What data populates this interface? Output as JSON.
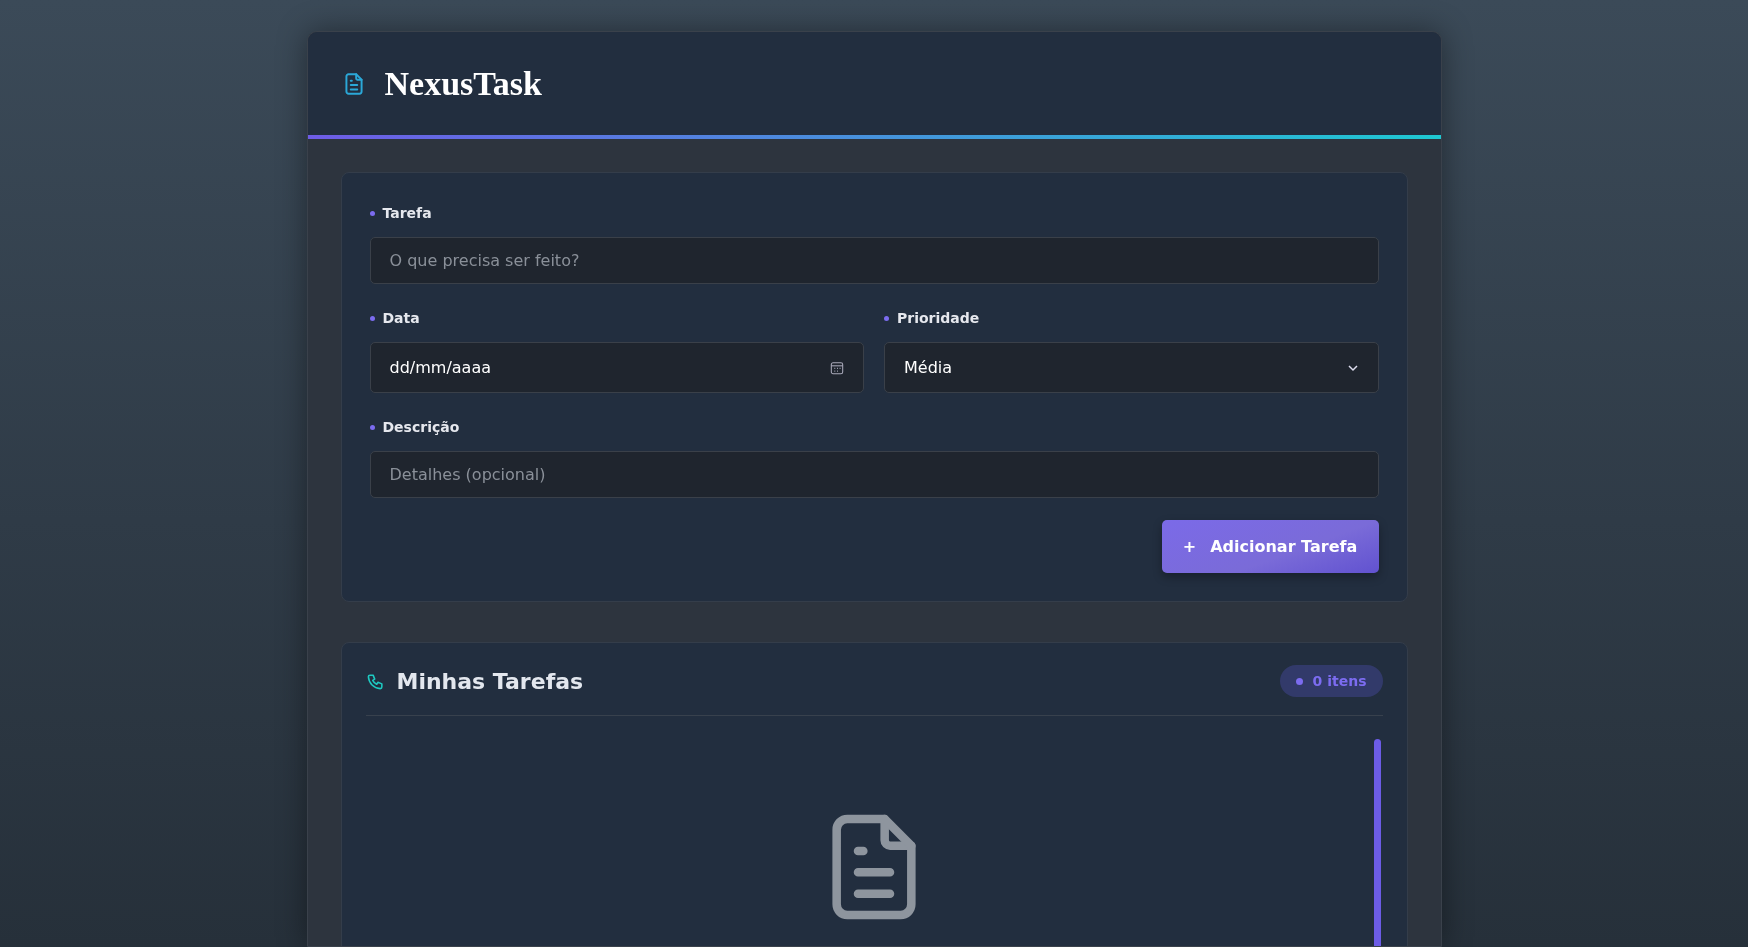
{
  "app": {
    "title": "NexusTask"
  },
  "form": {
    "fields": [
      {
        "kind": "text",
        "label": "Tarefa",
        "placeholder": "O que precisa ser feito?"
      },
      {
        "kind": "date",
        "label": "Data",
        "value": "dd/mm/aaaa"
      },
      {
        "kind": "select",
        "label": "Prioridade",
        "value": "Média"
      },
      {
        "kind": "text",
        "label": "Descrição",
        "placeholder": "Detalhes (opcional)"
      }
    ],
    "submit": {
      "icon": "+",
      "label": "Adicionar Tarefa"
    }
  },
  "task_list": {
    "title": "Minhas Tarefas",
    "count": "0 itens"
  }
}
